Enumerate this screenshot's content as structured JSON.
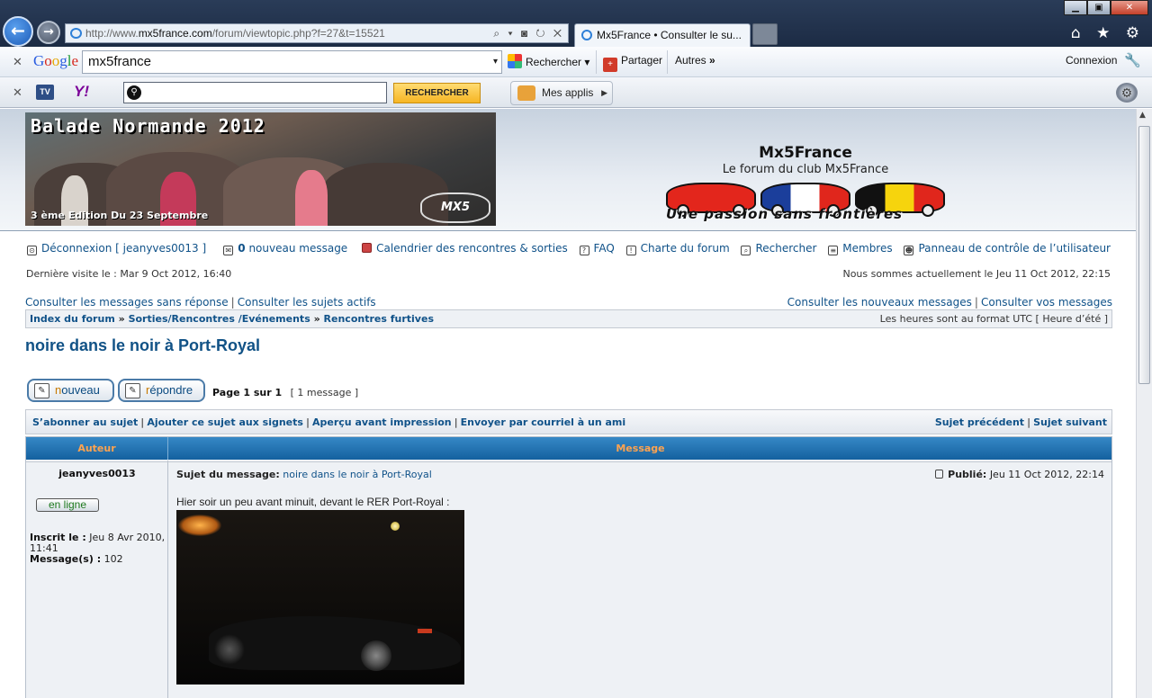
{
  "browser": {
    "url_prefix": "http://www.",
    "url_domain": "mx5france.com",
    "url_path": "/forum/viewtopic.php?f=27&t=15521",
    "tab_title": "Mx5France • Consulter le su...",
    "address_tools": "⌕ ▾ ◙ ↻ ✕",
    "window_controls": {
      "minimize": "▁",
      "maximize": "▣",
      "close": "✕"
    },
    "chrome_icons": "⌂ ★ ⚙"
  },
  "google_toolbar": {
    "close": "✕",
    "logo": [
      "G",
      "o",
      "o",
      "g",
      "l",
      "e"
    ],
    "search_value": "mx5france",
    "dropdown": "▾",
    "search_label": "Rechercher",
    "share_label": "Partager",
    "more_label": "Autres",
    "more_arrow": "»",
    "login_label": "Connexion",
    "wrench": "🔧"
  },
  "yahoo_toolbar": {
    "close": "✕",
    "tv_label": "TV",
    "logo": "Y!",
    "search_button": "RECHERCHER",
    "mesapps_label": "Mes applis",
    "mesapps_arrow": "▶",
    "settings": "⚙"
  },
  "header": {
    "banner_title": "Balade Normande 2012",
    "banner_sub": "3 ème Edition Du 23 Septembre",
    "banner_logo": "MX5",
    "site_title": "Mx5France",
    "site_desc": "Le forum du club Mx5France",
    "slogan": "Une passion sans frontières"
  },
  "user_bar": {
    "logout": "Déconnexion [ jeanyves0013 ]",
    "new_message_count": "0",
    "new_message_label": "nouveau message",
    "calendar": "Calendrier des rencontres & sorties",
    "faq": "FAQ",
    "charter": "Charte du forum",
    "search": "Rechercher",
    "members": "Membres",
    "control_panel": "Panneau de contrôle de l’utilisateur",
    "last_visit": "Dernière visite le : Mar 9 Oct 2012, 16:40",
    "now": "Nous sommes actuellement le Jeu 11 Oct 2012, 22:15"
  },
  "view_links": {
    "unanswered": "Consulter les messages sans réponse",
    "active": "Consulter les sujets actifs",
    "new_posts": "Consulter les nouveaux messages",
    "your_posts": "Consulter vos messages",
    "separator": "|"
  },
  "breadcrumb": {
    "items": [
      "Index du forum",
      "Sorties/Rencontres /Evénements",
      "Rencontres furtives"
    ],
    "separator": "»",
    "timezone": "Les heures sont au format UTC [ Heure d’été ]"
  },
  "topic": {
    "title": "noire dans le noir à Port-Royal",
    "new_button_prefix": "n",
    "new_button_rest": "ouveau",
    "reply_button_prefix": "r",
    "reply_button_rest": "épondre",
    "page_info": "Page 1 sur 1",
    "message_count": "[ 1 message ]",
    "actions": {
      "subscribe": "S’abonner au sujet",
      "bookmark": "Ajouter ce sujet aux signets",
      "print": "Aperçu avant impression",
      "email": "Envoyer par courriel à un ami",
      "prev": "Sujet précédent",
      "next": "Sujet suivant"
    }
  },
  "post_table": {
    "header_author": "Auteur",
    "header_message": "Message",
    "author": "jeanyves0013",
    "online": "en ligne",
    "joined_label": "Inscrit le :",
    "joined_value": "Jeu 8 Avr 2010, 11:41",
    "messages_label": "Message(s) :",
    "messages_value": "102",
    "subject_label": "Sujet du message:",
    "subject_value": "noire dans le noir à Port-Royal",
    "published_label": "Publié:",
    "published_value": "Jeu 11 Oct 2012, 22:14",
    "body": "Hier soir un peu avant minuit, devant le RER Port-Royal :"
  }
}
